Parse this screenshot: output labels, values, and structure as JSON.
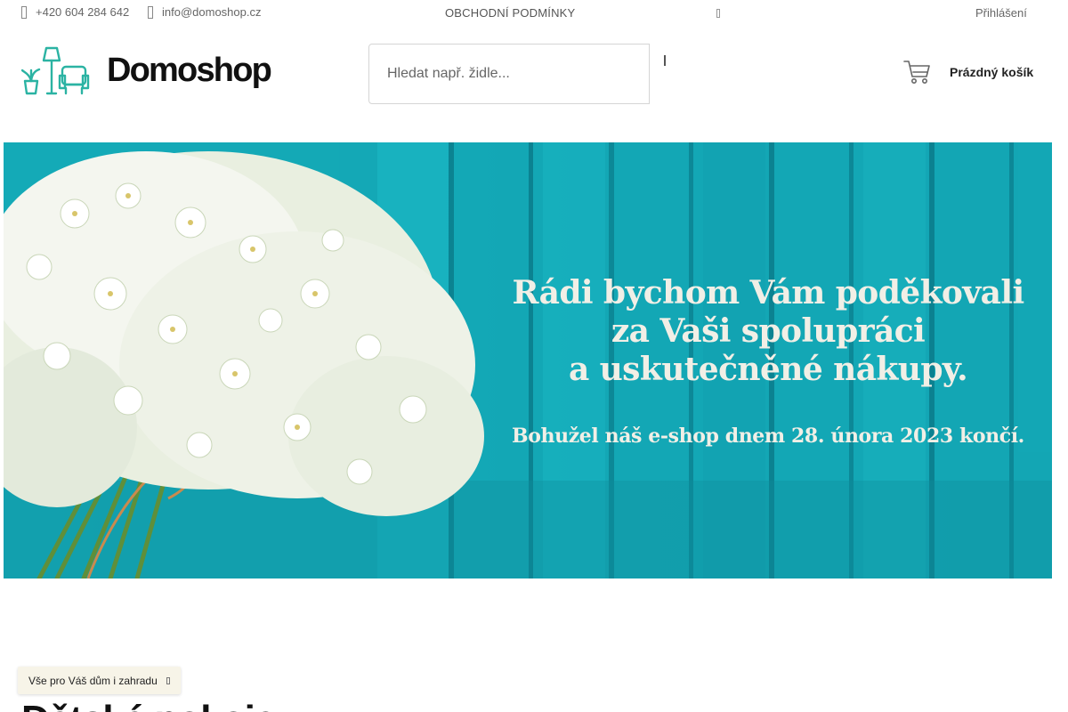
{
  "topbar": {
    "phone": "+420 604 284 642",
    "email": "info@domoshop.cz",
    "terms_link": "OBCHODNÍ PODMÍNKY",
    "login_link": "Přihlášení"
  },
  "header": {
    "brand": "Domoshop",
    "search_placeholder": "Hledat např. židle...",
    "cart_label": "Prázdný košík",
    "accent_color": "#2bb3a3"
  },
  "hero": {
    "headline": [
      "Rádi bychom Vám poděkovali",
      "za Vaši spolupráci",
      "a uskutečněné nákupy."
    ],
    "note": "Bohužel náš e-shop dnem 28. února 2023 končí.",
    "background_color": "#15aab8"
  },
  "bottom": {
    "category_pill": "Vše pro Váš dům i zahradu",
    "section_title": "Dětské pokoje"
  },
  "icons": [
    "phone-icon",
    "mail-icon",
    "flag-icon",
    "search-icon",
    "cart-icon",
    "chevron-right-icon"
  ]
}
